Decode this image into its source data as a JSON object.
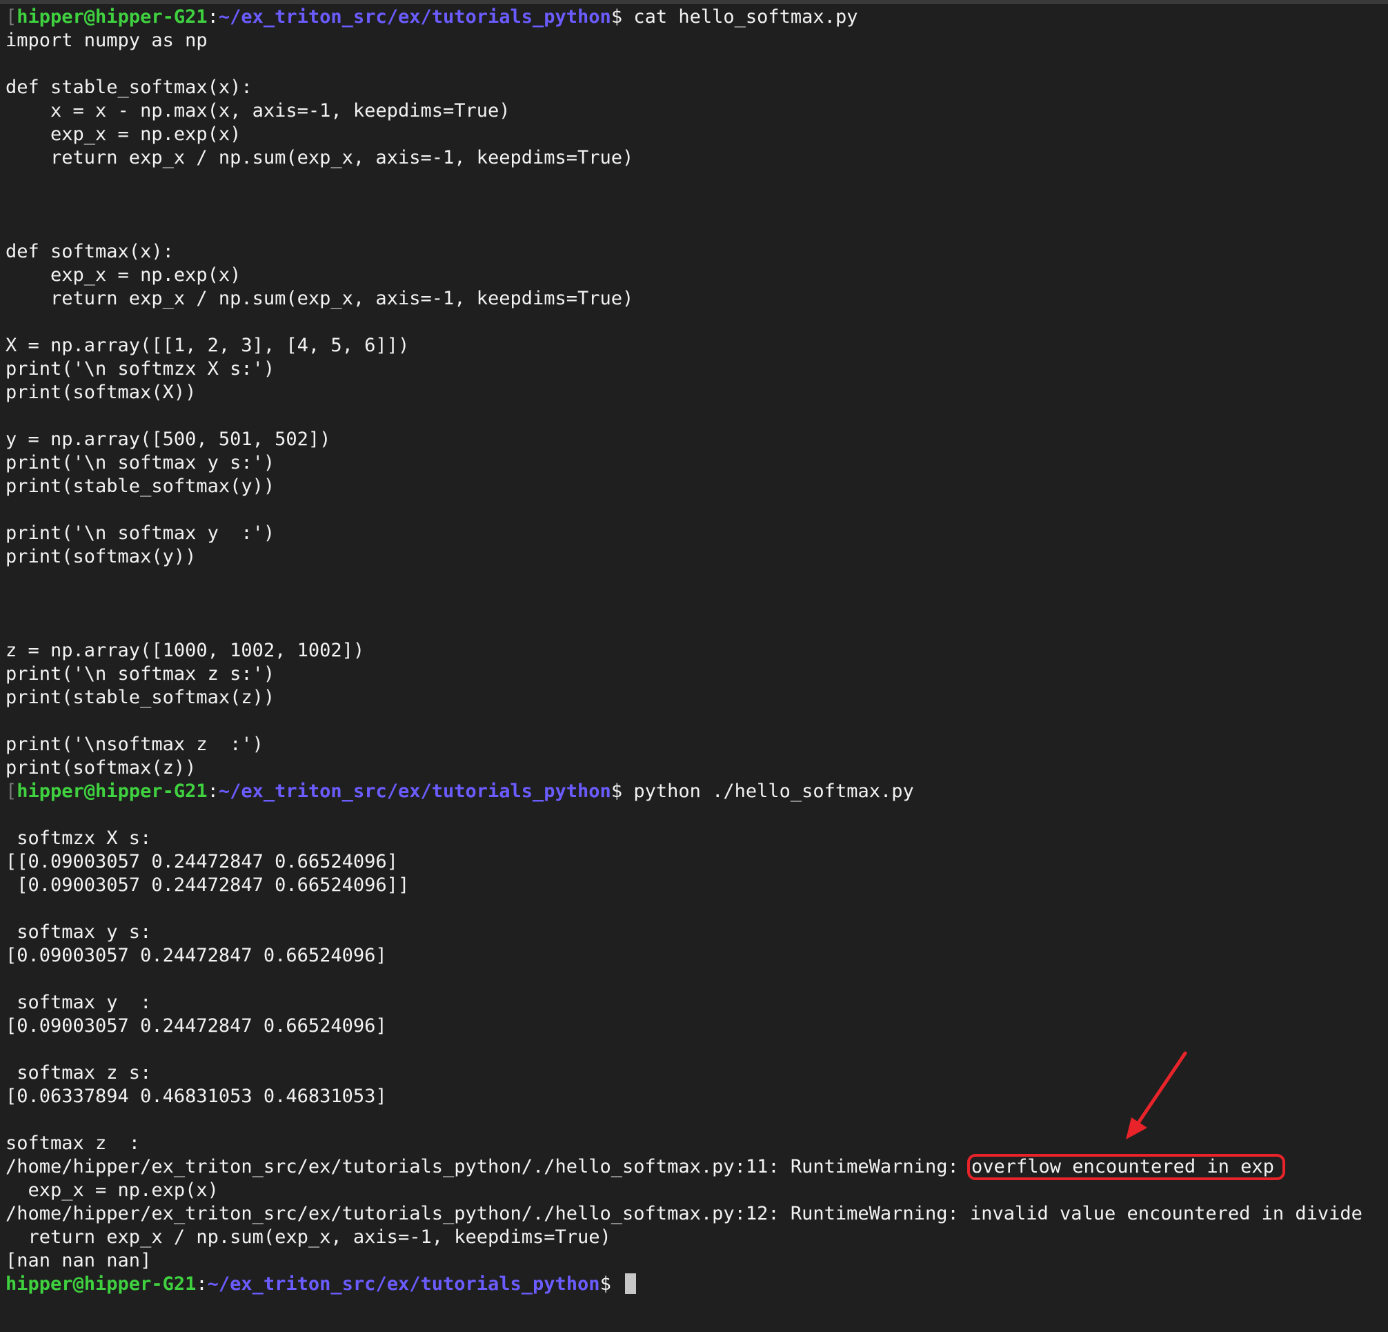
{
  "prompt": {
    "bracket": "[",
    "user": "hipper@hipper-G21",
    "colon": ":",
    "path": "~/ex_triton_src/ex/tutorials_python",
    "dollar": "$ "
  },
  "commands": {
    "cat": "cat hello_softmax.py",
    "run": "python ./hello_softmax.py"
  },
  "source_lines": [
    "import numpy as np",
    "",
    "def stable_softmax(x):",
    "    x = x - np.max(x, axis=-1, keepdims=True)",
    "    exp_x = np.exp(x)",
    "    return exp_x / np.sum(exp_x, axis=-1, keepdims=True)",
    "",
    "",
    "",
    "def softmax(x):",
    "    exp_x = np.exp(x)",
    "    return exp_x / np.sum(exp_x, axis=-1, keepdims=True)",
    "",
    "X = np.array([[1, 2, 3], [4, 5, 6]])",
    "print('\\n softmzx X s:')",
    "print(softmax(X))",
    "",
    "y = np.array([500, 501, 502])",
    "print('\\n softmax y s:')",
    "print(stable_softmax(y))",
    "",
    "print('\\n softmax y  :')",
    "print(softmax(y))",
    "",
    "",
    "",
    "z = np.array([1000, 1002, 1002])",
    "print('\\n softmax z s:')",
    "print(stable_softmax(z))",
    "",
    "print('\\nsoftmax z  :')",
    "print(softmax(z))"
  ],
  "output_lines": [
    "",
    " softmzx X s:",
    "[[0.09003057 0.24472847 0.66524096]",
    " [0.09003057 0.24472847 0.66524096]]",
    "",
    " softmax y s:",
    "[0.09003057 0.24472847 0.66524096]",
    "",
    " softmax y  :",
    "[0.09003057 0.24472847 0.66524096]",
    "",
    " softmax z s:",
    "[0.06337894 0.46831053 0.46831053]",
    "",
    "softmax z  :"
  ],
  "warning1": {
    "prefix": "/home/hipper/ex_triton_src/ex/tutorials_python/./hello_softmax.py:11: RuntimeWarning: ",
    "highlight": "overflow encountered in exp"
  },
  "after_lines": [
    "  exp_x = np.exp(x)",
    "/home/hipper/ex_triton_src/ex/tutorials_python/./hello_softmax.py:12: RuntimeWarning: invalid value encountered in divide",
    "  return exp_x / np.sum(exp_x, axis=-1, keepdims=True)",
    "[nan nan nan]"
  ],
  "colors": {
    "background": "#1f1f1f",
    "text": "#f2f2f2",
    "prompt_user": "#3fd13f",
    "prompt_path": "#6b5cff",
    "annotation": "#e8242a"
  }
}
